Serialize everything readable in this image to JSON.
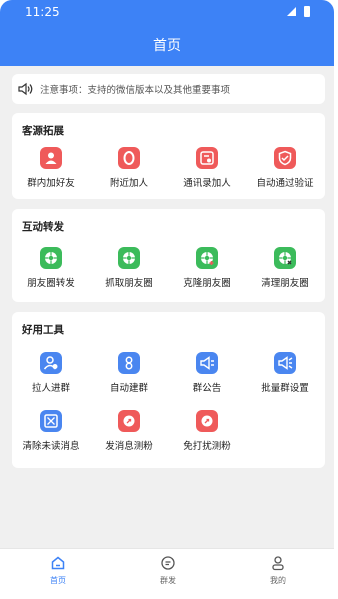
{
  "status_bar": {
    "time": "11:25"
  },
  "header": {
    "title": "首页"
  },
  "notice": {
    "text": "注意事项：支持的微信版本以及其他重要事项"
  },
  "sections": [
    {
      "title": "客源拓展",
      "items": [
        {
          "label": "群内加好友",
          "icon": "group-add-user-icon",
          "color": "#ef5a5a"
        },
        {
          "label": "附近加人",
          "icon": "nearby-location-icon",
          "color": "#ef5a5a"
        },
        {
          "label": "通讯录加人",
          "icon": "contacts-icon",
          "color": "#ef5a5a"
        },
        {
          "label": "自动通过验证",
          "icon": "verify-shield-icon",
          "color": "#ef5a5a"
        }
      ]
    },
    {
      "title": "互动转发",
      "items": [
        {
          "label": "朋友圈转发",
          "icon": "moments-forward-icon",
          "color": "#3cbb5b"
        },
        {
          "label": "抓取朋友圈",
          "icon": "moments-grab-icon",
          "color": "#3cbb5b"
        },
        {
          "label": "克隆朋友圈",
          "icon": "moments-clone-icon",
          "color": "#3cbb5b"
        },
        {
          "label": "清理朋友圈",
          "icon": "moments-clean-icon",
          "color": "#3cbb5b"
        }
      ]
    },
    {
      "title": "好用工具",
      "items": [
        {
          "label": "拉人进群",
          "icon": "invite-to-group-icon",
          "color": "#4a86f0"
        },
        {
          "label": "自动建群",
          "icon": "auto-create-group-icon",
          "color": "#4a86f0"
        },
        {
          "label": "群公告",
          "icon": "megaphone-icon",
          "color": "#4a86f0"
        },
        {
          "label": "批量群设置",
          "icon": "batch-megaphone-icon",
          "color": "#4a86f0"
        },
        {
          "label": "清除未读消息",
          "icon": "clear-message-icon",
          "color": "#4a86f0"
        },
        {
          "label": "发消息测粉",
          "icon": "send-test-icon",
          "color": "#ef5a5a"
        },
        {
          "label": "免打扰测粉",
          "icon": "silent-test-icon",
          "color": "#ef5a5a"
        }
      ]
    }
  ],
  "tabbar": [
    {
      "label": "首页",
      "icon": "home-icon",
      "active": true
    },
    {
      "label": "群发",
      "icon": "chat-icon",
      "active": false
    },
    {
      "label": "我的",
      "icon": "profile-icon",
      "active": false
    }
  ],
  "colors": {
    "primary": "#3d82f6",
    "background": "#f0f0f0"
  }
}
